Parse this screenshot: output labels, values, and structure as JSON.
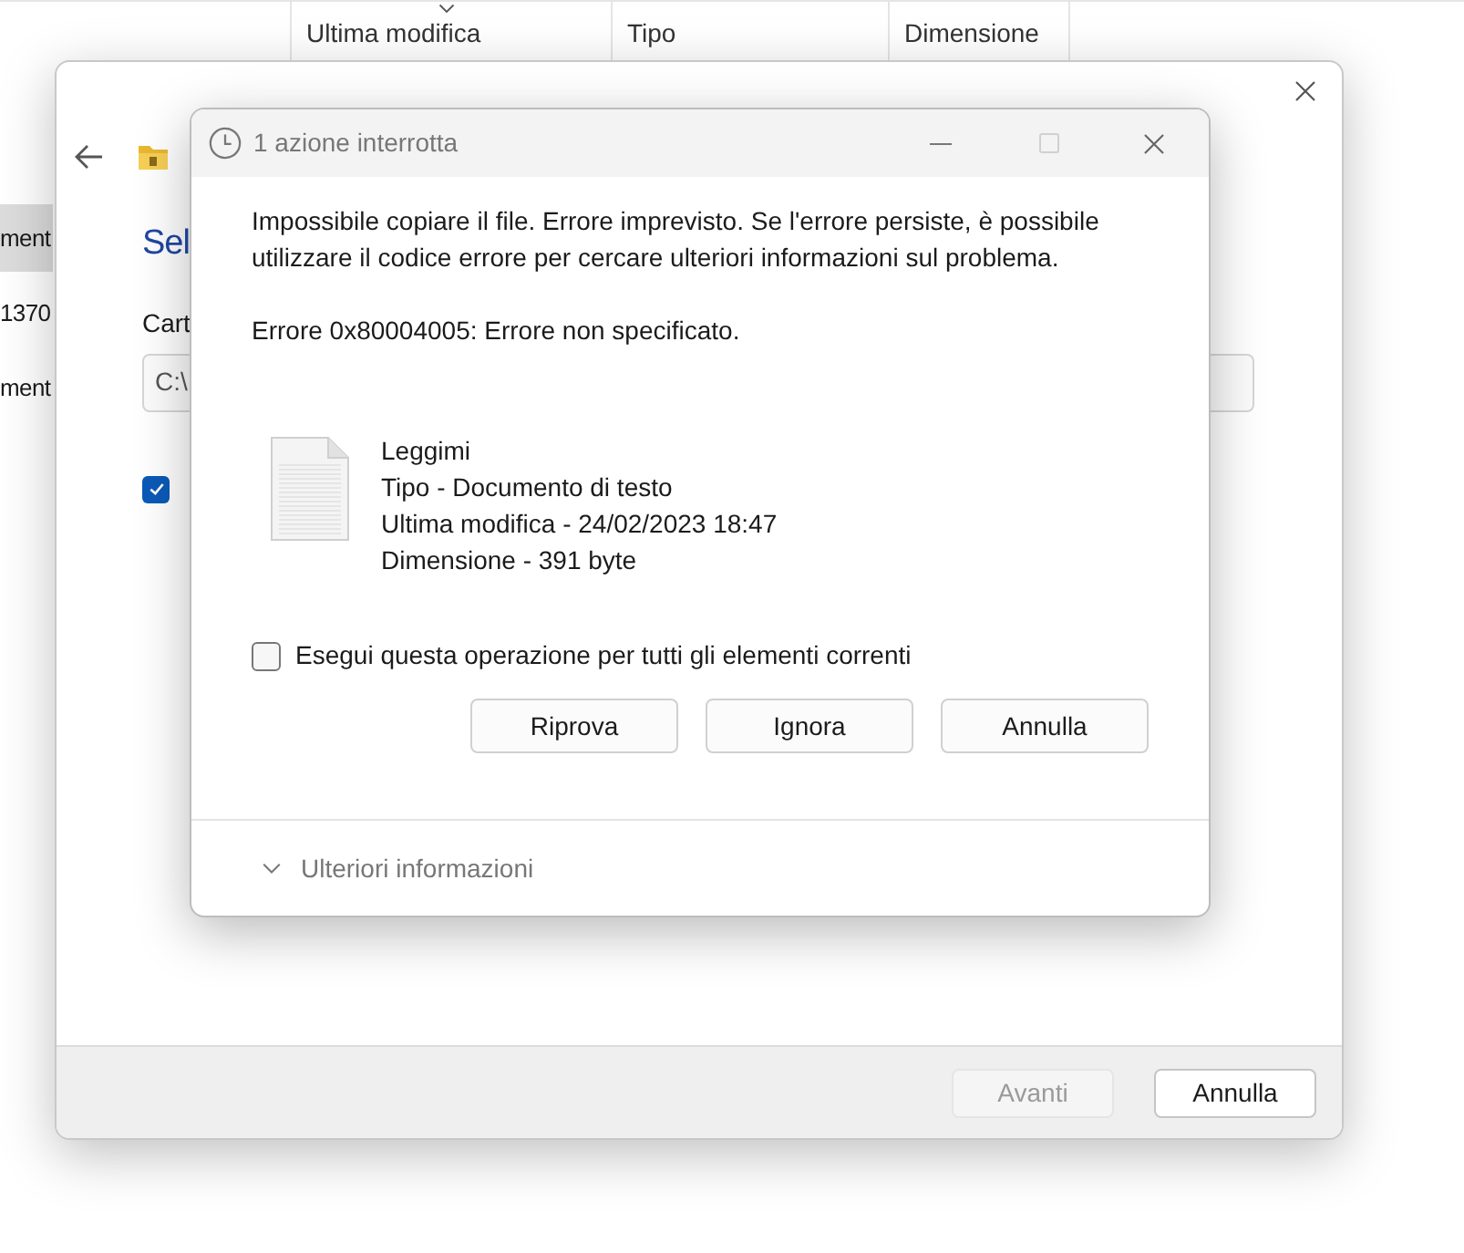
{
  "explorer": {
    "columns": [
      {
        "label": "Ultima modifica",
        "sorted": true
      },
      {
        "label": "Tipo",
        "sorted": false
      },
      {
        "label": "Dimensione",
        "sorted": false
      }
    ],
    "sidebar": [
      {
        "label": "ment",
        "selected": true
      },
      {
        "label": "1370",
        "selected": false
      },
      {
        "label": "ment",
        "selected": false
      }
    ]
  },
  "wizard": {
    "heading": "Sel",
    "field_label": "Cart",
    "path_value": "C:\\",
    "checkbox": {
      "checked": true
    },
    "buttons": [
      {
        "label": "Avanti",
        "disabled": true
      },
      {
        "label": "Annulla",
        "disabled": false
      }
    ]
  },
  "dialog": {
    "title": "1 azione interrotta",
    "message": "Impossibile copiare il file. Errore imprevisto. Se l'errore persiste, è possibile utilizzare il codice errore per cercare ulteriori informazioni sul problema.",
    "error": "Errore 0x80004005: Errore non specificato.",
    "file": {
      "name": "Leggimi",
      "details": [
        "Tipo - Documento di testo",
        "Ultima modifica - 24/02/2023 18:47",
        "Dimensione - 391 byte"
      ]
    },
    "apply_all": {
      "label": "Esegui questa operazione per tutti gli elementi correnti",
      "checked": false
    },
    "buttons": [
      {
        "label": "Riprova"
      },
      {
        "label": "Ignora"
      },
      {
        "label": "Annulla"
      }
    ],
    "details_toggle": {
      "label": "Ulteriori informazioni",
      "expanded": false
    }
  }
}
